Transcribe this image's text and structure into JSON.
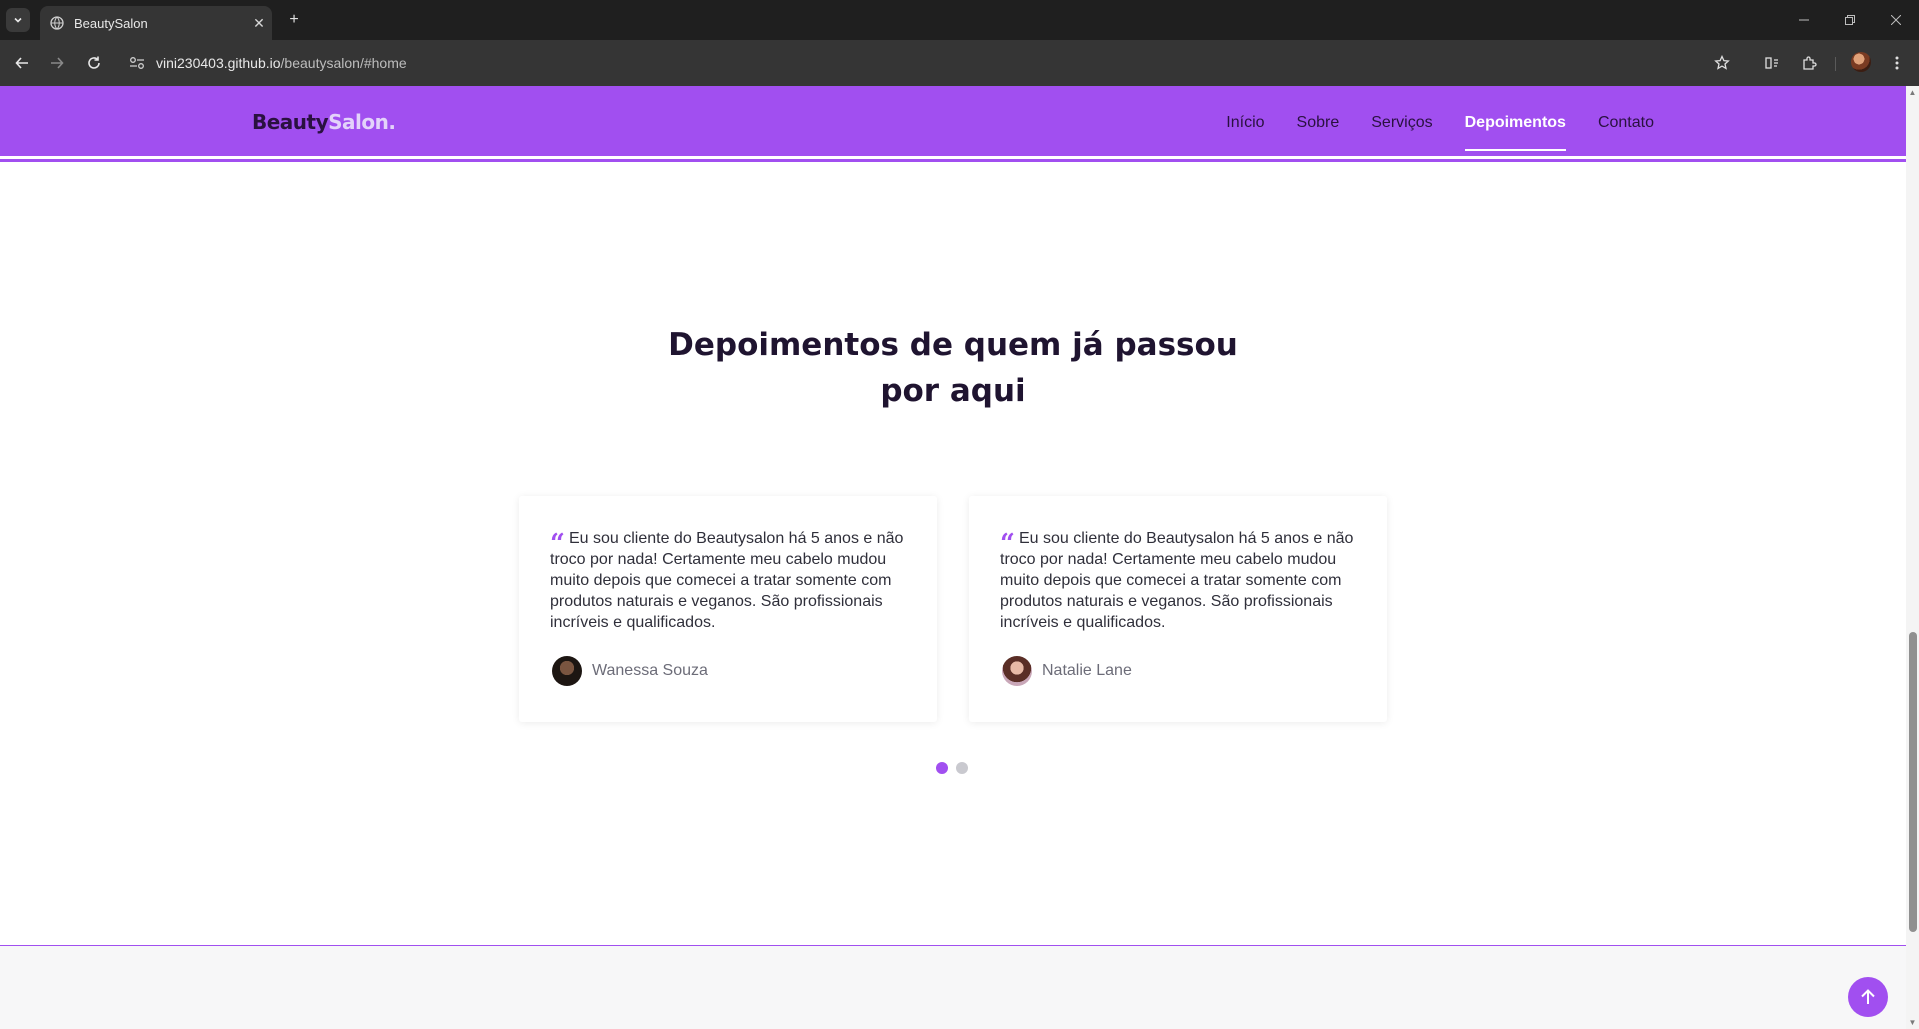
{
  "browser": {
    "tab_title": "BeautySalon",
    "new_tab_symbol": "+",
    "url_host": "vini230403.github.io",
    "url_path": "/beautysalon/#home"
  },
  "site": {
    "logo_part1": "Beauty",
    "logo_part2": "Salon.",
    "nav": [
      {
        "label": "Início",
        "active": false
      },
      {
        "label": "Sobre",
        "active": false
      },
      {
        "label": "Serviços",
        "active": false
      },
      {
        "label": "Depoimentos",
        "active": true
      },
      {
        "label": "Contato",
        "active": false
      }
    ],
    "accent_color": "#a14ff0"
  },
  "testimonials": {
    "title_line1": "Depoimentos de quem já passou",
    "title_line2": "por aqui",
    "cards": [
      {
        "text": "Eu sou cliente do Beautysalon há 5 anos e não troco por nada! Certamente meu cabelo mudou muito depois que comecei a tratar somente com produtos naturais e veganos. São profissionais incríveis e qualificados.",
        "author": "Wanessa Souza"
      },
      {
        "text": "Eu sou cliente do Beautysalon há 5 anos e não troco por nada! Certamente meu cabelo mudou muito depois que comecei a tratar somente com produtos naturais e veganos. São profissionais incríveis e qualificados.",
        "author": "Natalie Lane"
      }
    ],
    "pagination": {
      "pages": 2,
      "active": 1
    }
  }
}
